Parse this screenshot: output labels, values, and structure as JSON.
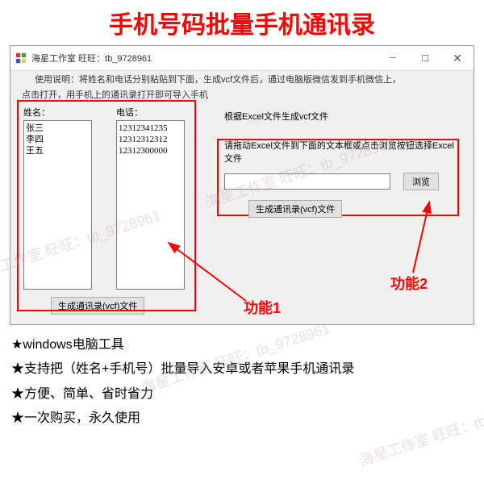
{
  "mainTitle": "手机号码批量手机通讯录",
  "window": {
    "title": "海星工作室 旺旺：tb_9728961",
    "instructions1": "使用说明：将姓名和电话分别粘贴到下面，生成vcf文件后，通过电脑版微信发到手机微信上，",
    "instructions2": "点击打开，用手机上的通讯录打开即可导入手机",
    "nameLabel": "姓名：",
    "phoneLabel": "电话：",
    "nameContent": "张三\n李四\n王五",
    "phoneContent": "12312341235\n12312312312\n12312300000",
    "genBtn1": "生成通讯录(vcf)文件",
    "rightText1": "根据Excel文件生成vcf文件",
    "rightText2": "请拖动Excel文件到下面的文本框或点击浏览按钮选择Excel文件",
    "browseBtn": "浏览",
    "genBtn2": "生成通讯录(vcf)文件"
  },
  "callout1": "功能1",
  "callout2": "功能2",
  "bullets": {
    "b1": "★windows电脑工具",
    "b2": "★支持把（姓名+手机号）批量导入安卓或者苹果手机通讯录",
    "b3": "★方便、简单、省时省力",
    "b4": "★一次购买，永久使用"
  },
  "watermark": "海星工作室 旺旺：tb_9728961"
}
